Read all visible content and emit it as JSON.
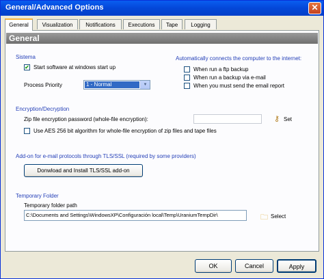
{
  "window": {
    "title": "General/Advanced Options",
    "close_glyph": "✕"
  },
  "tabs": [
    {
      "label": "General",
      "active": true
    },
    {
      "label": "Visualization",
      "active": false
    },
    {
      "label": "Notifications",
      "active": false
    },
    {
      "label": "Executions",
      "active": false
    },
    {
      "label": "Tape",
      "active": false
    },
    {
      "label": "Logging",
      "active": false
    }
  ],
  "header": "General",
  "sistema": {
    "title": "Sistema",
    "start_checkbox": {
      "label": "Start software at windows start up",
      "checked": true
    },
    "priority_label": "Process Priority",
    "priority_value": "1 - Normal"
  },
  "internet": {
    "title": "Automatically connects the computer to the internet:",
    "options": [
      {
        "label": "When run a ftp backup",
        "checked": false
      },
      {
        "label": "When run a backup via e-mail",
        "checked": false
      },
      {
        "label": "When you must send the email report",
        "checked": false
      }
    ]
  },
  "encryption": {
    "title": "Encryption/Decryption",
    "password_label": "Zip file encryption password (whole-file encryption):",
    "password_value": "",
    "set_label": "Set",
    "set_icon": "key-icon",
    "aes_checkbox": {
      "label": "Use AES 256 bit algorithm for whole-file encryption of zip files and tape files",
      "checked": false
    }
  },
  "addon": {
    "title": "Add-on for e-mail protocols through TLS/SSL (required by some providers)",
    "button": "Donwload and Install TLS/SSL add-on"
  },
  "temp": {
    "title": "Temporary Folder",
    "path_label": "Temporary folder path",
    "path_value": "C:\\Documents and Settings\\WindowsXP\\Configuración local\\Temp\\UraniumTempDir\\",
    "select_label": "Select",
    "select_icon": "folder-icon"
  },
  "footer": {
    "ok": "OK",
    "cancel": "Cancel",
    "apply": "Apply"
  },
  "colors": {
    "title_bar": "#0447d8",
    "section": "#2540b8",
    "header": "#808080",
    "tab_highlight": "#f8b33a"
  }
}
